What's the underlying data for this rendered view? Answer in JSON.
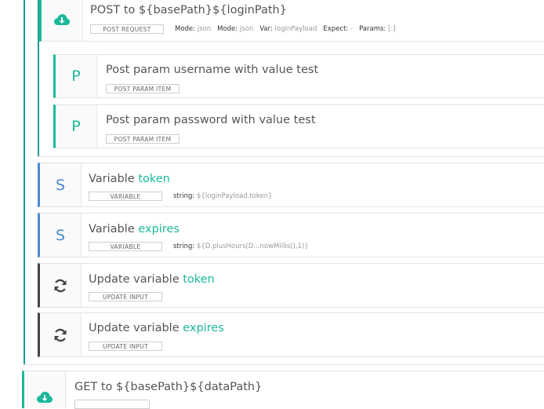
{
  "request_post": {
    "method": "POST",
    "to_word": "to",
    "path": "${basePath}${loginPath}",
    "tag": "POST REQUEST",
    "meta": [
      {
        "k": "Mode:",
        "v": "json"
      },
      {
        "k": "Mode:",
        "v": "json"
      },
      {
        "k": "Var:",
        "v": "loginPayload"
      },
      {
        "k": "Expect:",
        "v": "-"
      },
      {
        "k": "Params:",
        "v": "[:]"
      }
    ],
    "params": [
      {
        "letter": "P",
        "text": "Post param username with value test",
        "tag": "POST PARAM ITEM"
      },
      {
        "letter": "P",
        "text": "Post param password with value test",
        "tag": "POST PARAM ITEM"
      }
    ]
  },
  "variables": [
    {
      "letter": "S",
      "prefix": "Variable",
      "name": "token",
      "tag": "VARIABLE",
      "type_label": "string:",
      "value": "${loginPayload.token}"
    },
    {
      "letter": "S",
      "prefix": "Variable",
      "name": "expires",
      "tag": "VARIABLE",
      "type_label": "string:",
      "value": "${D.plusHours(D...nowMillis(),1)}"
    }
  ],
  "updates": [
    {
      "icon": "refresh-icon",
      "prefix": "Update variable",
      "name": "token",
      "tag": "UPDATE INPUT"
    },
    {
      "icon": "refresh-icon",
      "prefix": "Update variable",
      "name": "expires",
      "tag": "UPDATE INPUT"
    }
  ],
  "request_get": {
    "method": "GET",
    "to_word": "to",
    "path": "${basePath}${dataPath}",
    "icon": "cloud-download-icon"
  },
  "colors": {
    "accent": "#1bb99a",
    "blue": "#4a8ad0",
    "dark": "#444444"
  }
}
